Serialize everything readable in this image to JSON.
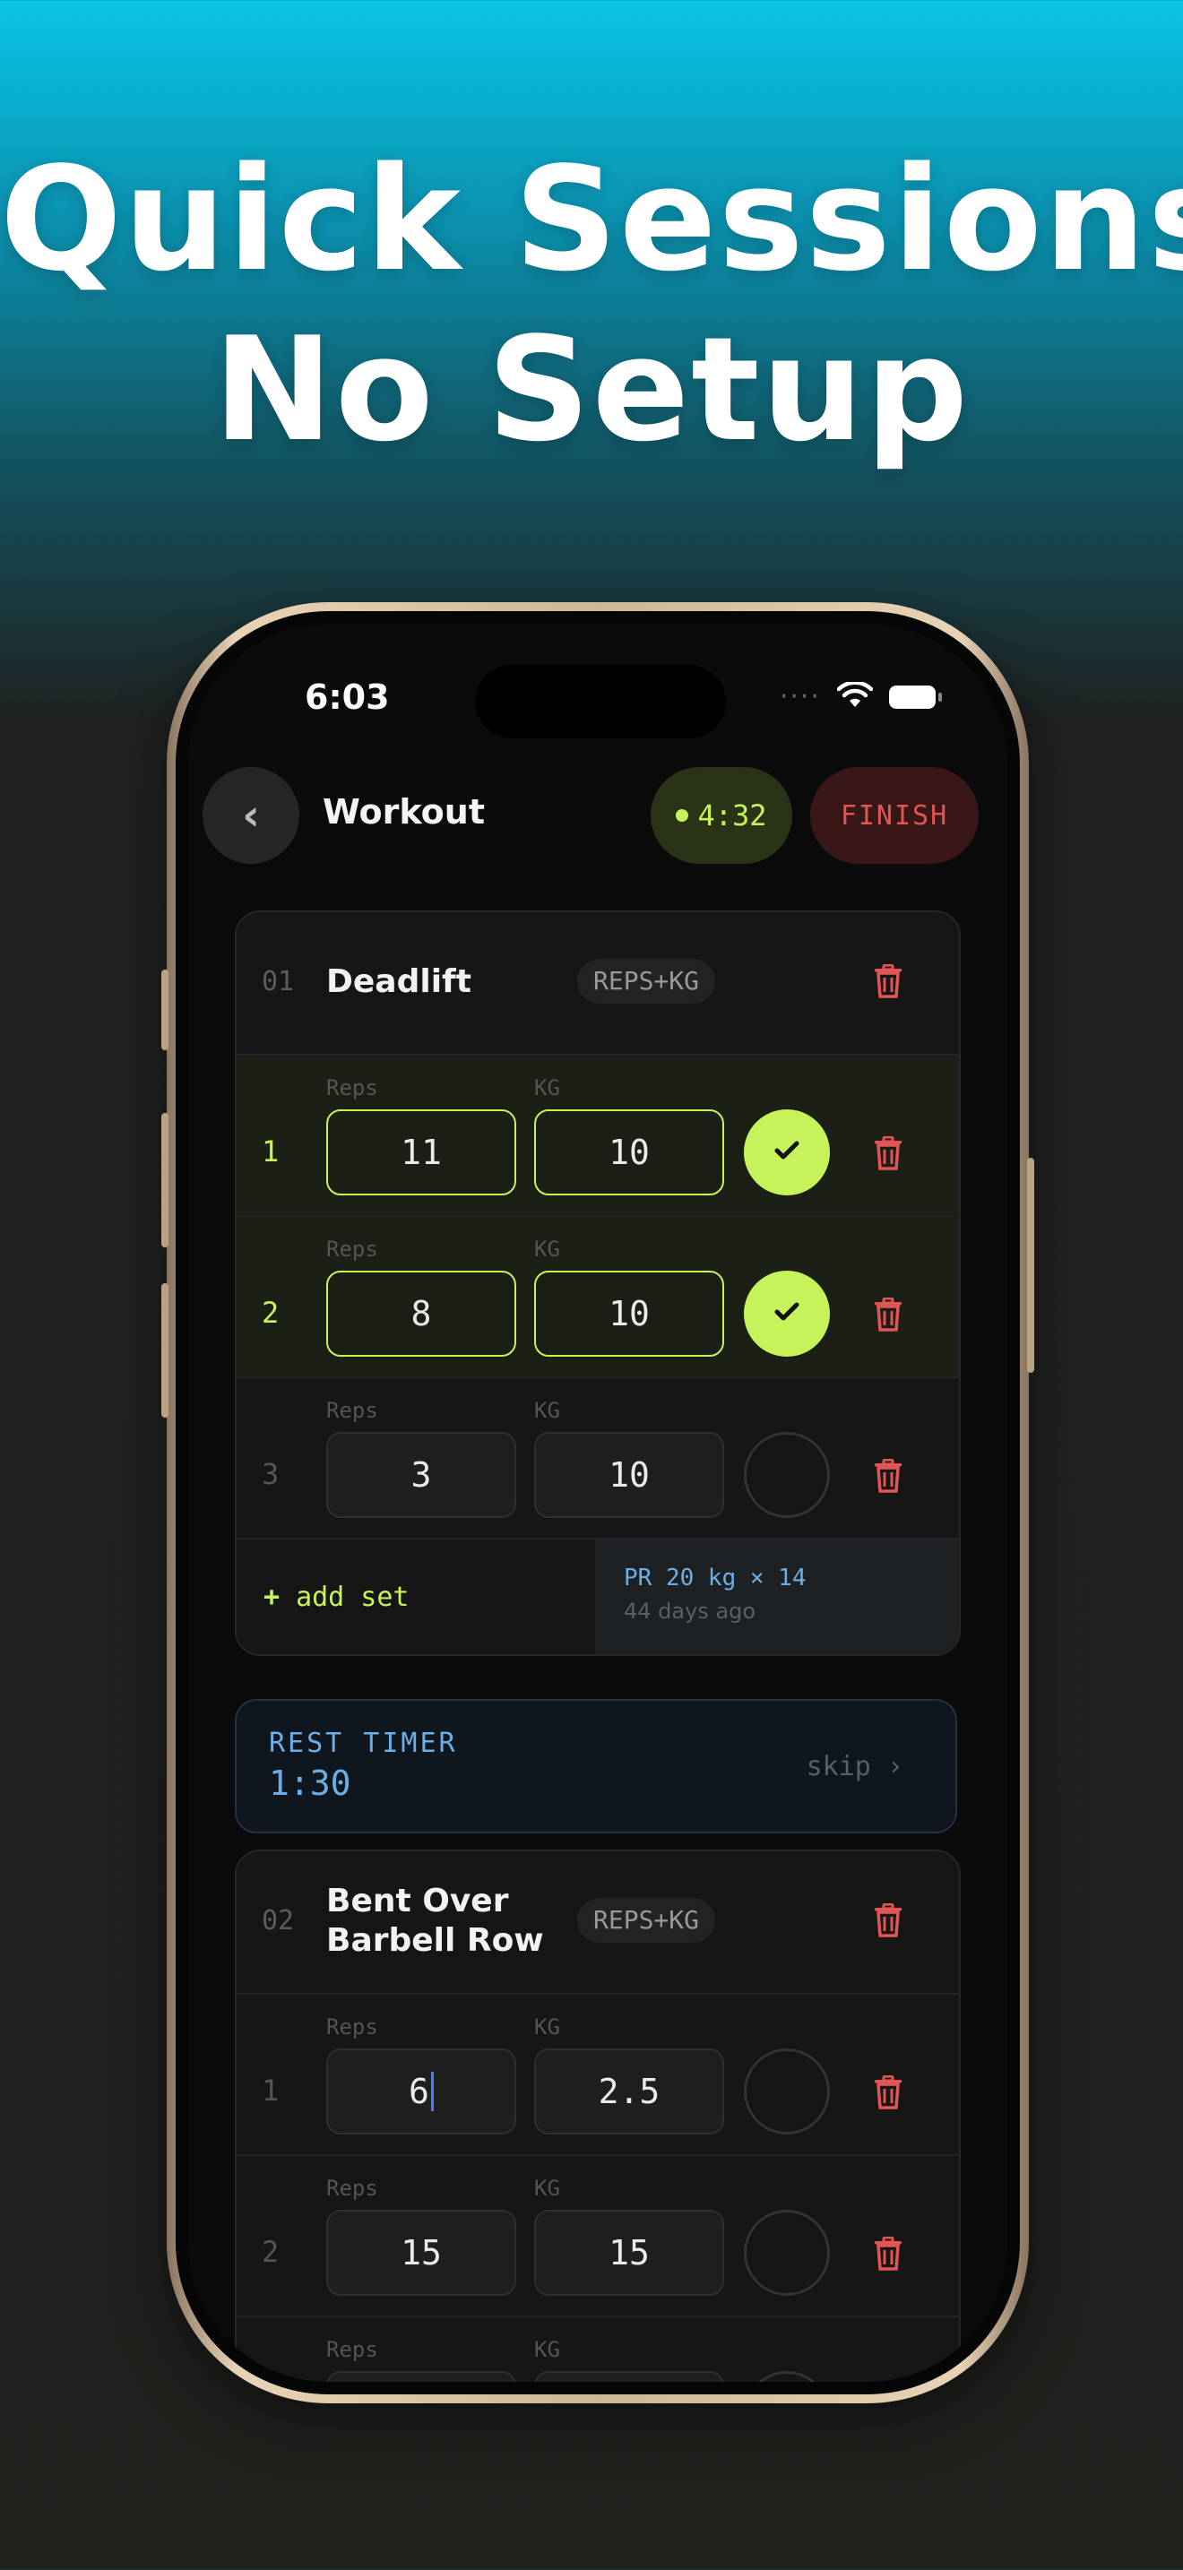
{
  "headline": {
    "line1": "Quick Sessions",
    "line2": "No Setup"
  },
  "status_bar": {
    "time": "6:03",
    "signal_dots": "····"
  },
  "nav": {
    "back_glyph": "‹",
    "title": "Workout",
    "elapsed": "4:32",
    "finish_label": "FINISH"
  },
  "colors": {
    "accent": "#c6f25a",
    "danger": "#e25555",
    "info": "#6aaee8"
  },
  "exercises": [
    {
      "number": "01",
      "name": "Deadlift",
      "mode": "REPS+KG",
      "sets": [
        {
          "num": "1",
          "reps_label": "Reps",
          "kg_label": "KG",
          "reps": "11",
          "kg": "10",
          "done": true
        },
        {
          "num": "2",
          "reps_label": "Reps",
          "kg_label": "KG",
          "reps": "8",
          "kg": "10",
          "done": true
        },
        {
          "num": "3",
          "reps_label": "Reps",
          "kg_label": "KG",
          "reps": "3",
          "kg": "10",
          "done": false
        }
      ],
      "add_set_icon": "+",
      "add_set_label": "add set",
      "pr": {
        "text": "PR 20 kg × 14",
        "when": "44 days ago"
      }
    },
    {
      "number": "02",
      "name_line1": "Bent Over",
      "name_line2": "Barbell Row",
      "mode": "REPS+KG",
      "sets": [
        {
          "num": "1",
          "reps_label": "Reps",
          "kg_label": "KG",
          "reps": "6",
          "kg": "2.5",
          "done": false
        },
        {
          "num": "2",
          "reps_label": "Reps",
          "kg_label": "KG",
          "reps": "15",
          "kg": "15",
          "done": false
        },
        {
          "num": "",
          "reps_label": "Reps",
          "kg_label": "KG",
          "reps": "",
          "kg": "",
          "done": false
        }
      ]
    }
  ],
  "rest_timer": {
    "label": "REST TIMER",
    "time": "1:30",
    "skip_label": "skip ›"
  },
  "icons": {
    "back": "chevron-left-icon",
    "trash": "trash-icon",
    "check": "checkmark-icon",
    "wifi": "wifi-icon",
    "battery": "battery-icon"
  }
}
